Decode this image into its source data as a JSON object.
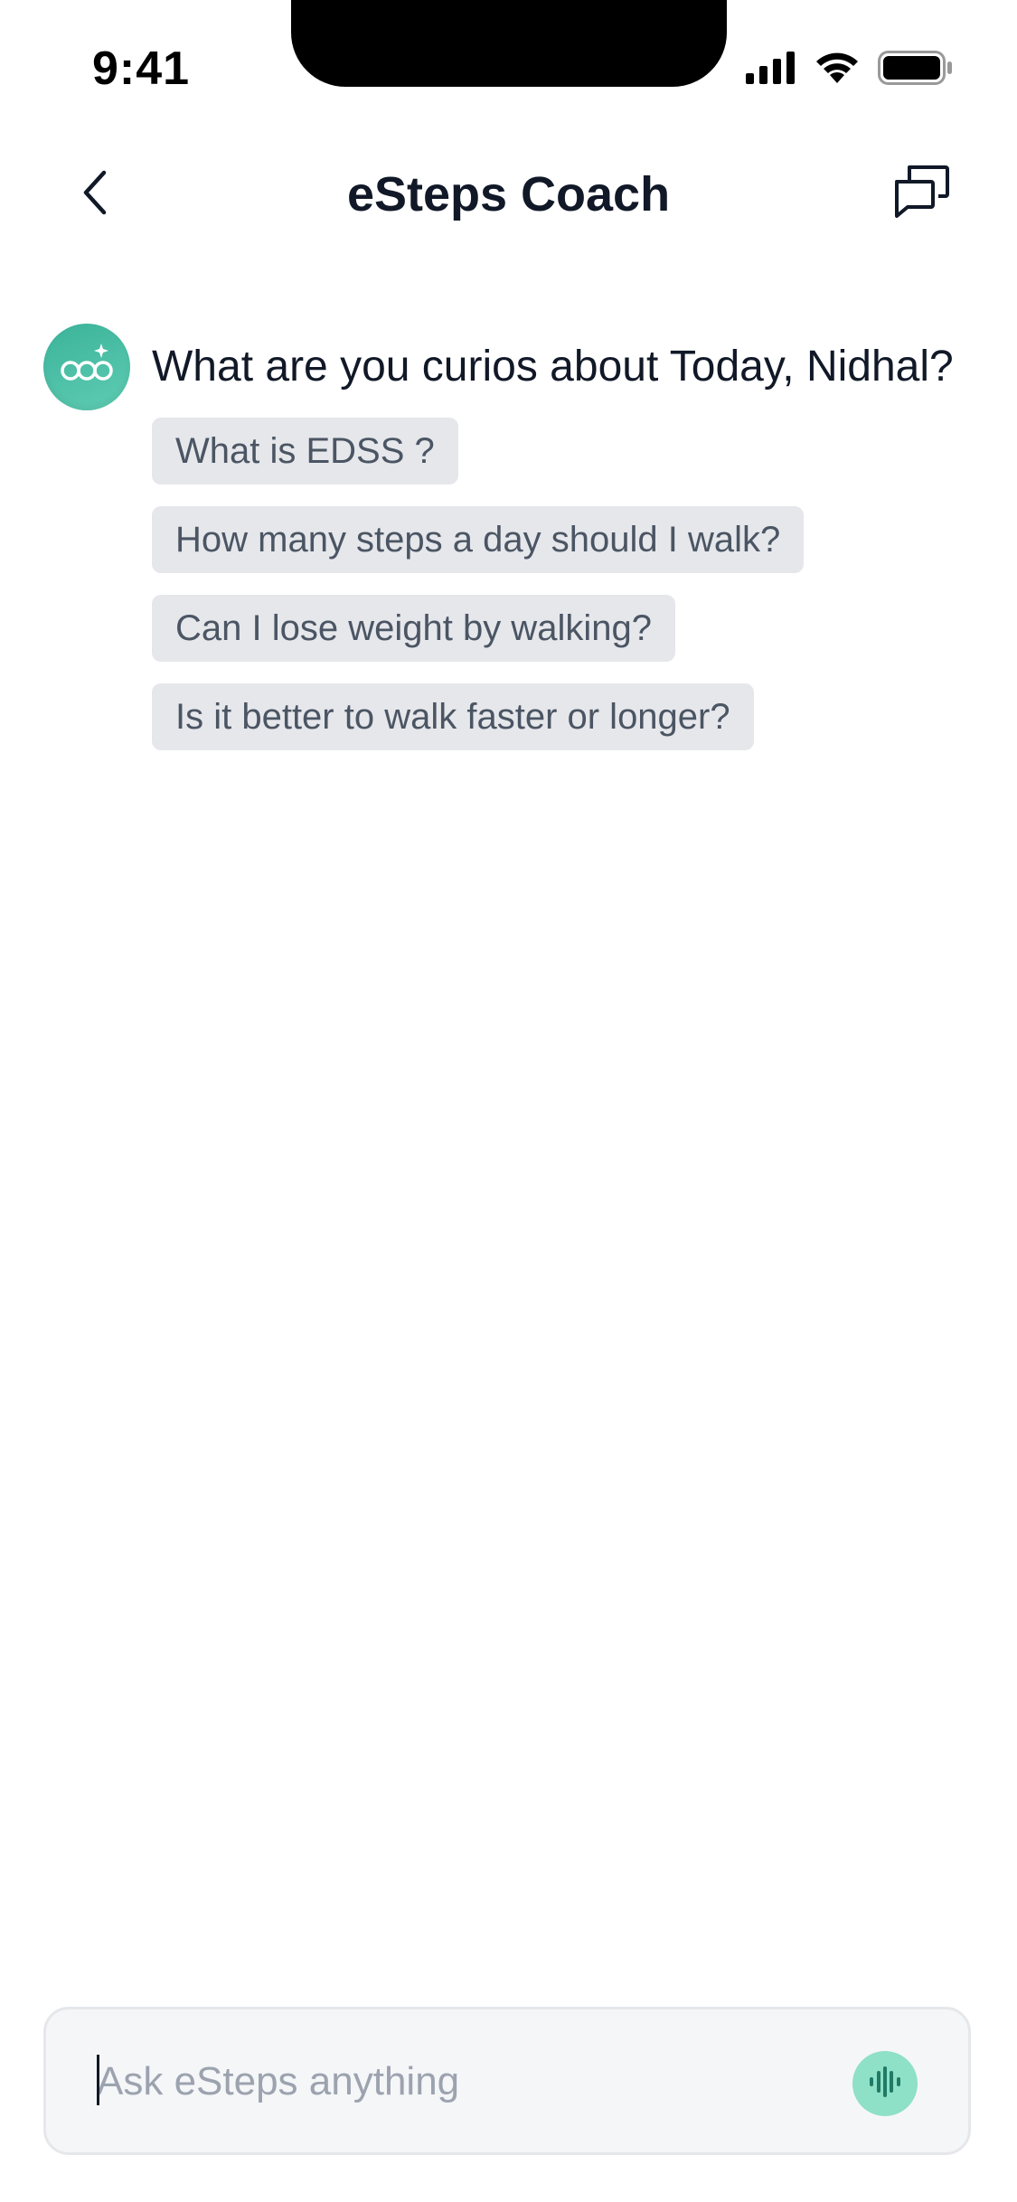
{
  "status_bar": {
    "time": "9:41",
    "icons": [
      "cellular-signal-icon",
      "wifi-icon",
      "battery-icon"
    ]
  },
  "header": {
    "title": "eSteps Coach",
    "back_icon": "chevron-left-icon",
    "chats_icon": "chat-bubbles-icon"
  },
  "conversation": {
    "avatar_icon": "coach-avatar-icon",
    "greeting": "What are you curios about Today, Nidhal?",
    "suggestions": [
      "What is EDSS ?",
      "How many steps a day should I walk?",
      "Can I lose weight by walking?",
      "Is it better to walk faster or longer?"
    ]
  },
  "composer": {
    "placeholder": "Ask eSteps anything",
    "value": "",
    "voice_icon": "voice-waveform-icon"
  },
  "colors": {
    "accent": "#4fc3a9",
    "voice_button": "#8ee0c6",
    "chip_background": "#e5e7eb",
    "text_primary": "#111827",
    "text_secondary": "#4b5563",
    "placeholder": "#9ca3af"
  }
}
